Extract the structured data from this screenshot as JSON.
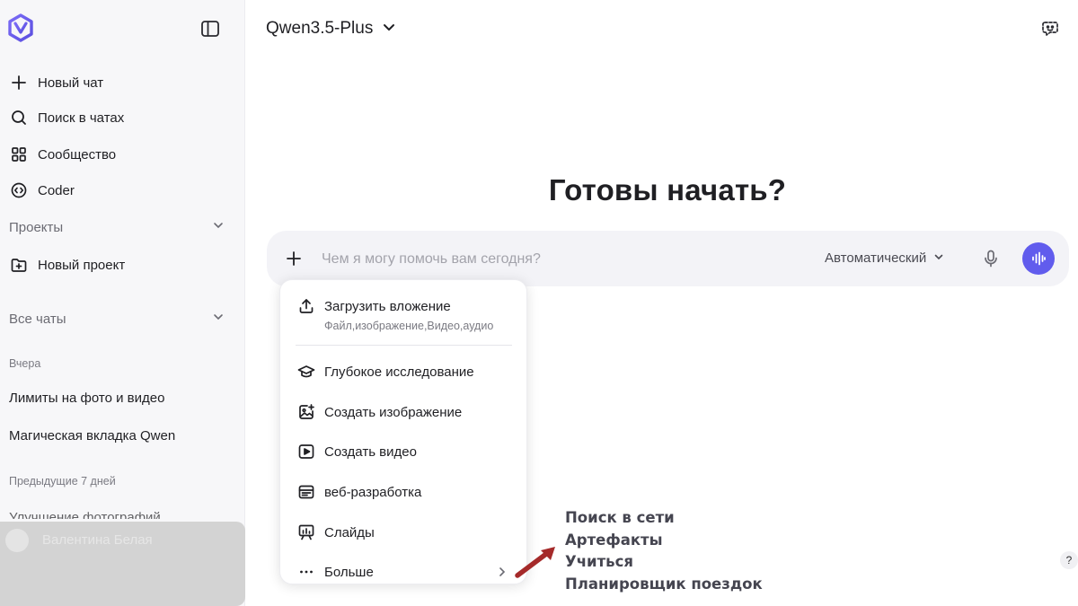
{
  "sidebar": {
    "logo_icon": "qwen-logo-icon",
    "collapse_icon": "sidebar-toggle-icon",
    "nav": [
      {
        "label": "Новый чат",
        "icon": "plus-icon"
      },
      {
        "label": "Поиск в чатах",
        "icon": "search-icon"
      },
      {
        "label": "Сообщество",
        "icon": "grid-icon"
      },
      {
        "label": "Coder",
        "icon": "code-icon"
      }
    ],
    "projects_label": "Проекты",
    "new_project_label": "Новый проект",
    "all_chats_label": "Все чаты",
    "groups": [
      {
        "label": "Вчера",
        "chats": [
          "Лимиты на фото и видео",
          "Магическая вкладка Qwen"
        ]
      },
      {
        "label": "Предыдущие 7 дней",
        "chats": [
          "Улучшение фотографий"
        ]
      }
    ],
    "user_name": "Валентина Белая"
  },
  "header": {
    "model": "Qwen3.5-Plus",
    "right_icon": "temporary-chat-icon"
  },
  "main": {
    "headline": "Готовы начать?",
    "composer": {
      "placeholder": "Чем я могу помочь вам сегодня?",
      "value": "",
      "mode": "Автоматический"
    }
  },
  "menu": {
    "upload_label": "Загрузить вложение",
    "upload_sub": "Файл,изображение,Видео,аудио",
    "items": [
      {
        "label": "Глубокое исследование",
        "icon": "graduation-cap-icon"
      },
      {
        "label": "Создать изображение",
        "icon": "image-plus-icon"
      },
      {
        "label": "Создать видео",
        "icon": "video-icon"
      },
      {
        "label": "веб-разработка",
        "icon": "browser-window-icon"
      },
      {
        "label": "Слайды",
        "icon": "presentation-icon"
      },
      {
        "label": "Больше",
        "icon": "more-dots-icon"
      }
    ]
  },
  "annotation": {
    "items": [
      "Поиск в сети",
      "Артефакты",
      "Учиться",
      "Планировщик поездок"
    ],
    "arrow_color": "#a52a2a"
  },
  "help_label": "?",
  "colors": {
    "accent": "#615ced",
    "sidebar_bg": "#f7f7f9",
    "composer_bg": "#f3f3f7"
  }
}
